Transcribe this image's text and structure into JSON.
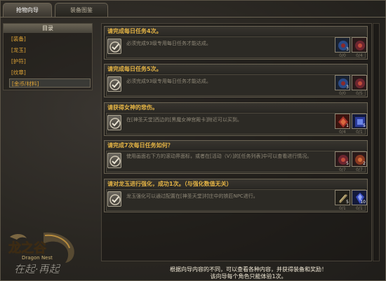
{
  "tabs": [
    {
      "label": "抢物向导"
    },
    {
      "label": "装备图鉴"
    }
  ],
  "sidebar": {
    "title": "目录",
    "items": [
      {
        "label": "[装备]"
      },
      {
        "label": "[龙玉]"
      },
      {
        "label": "[护符]"
      },
      {
        "label": "[纹章]"
      },
      {
        "label": "[金币/材料]"
      }
    ]
  },
  "logo": {
    "name": "龙之谷",
    "sub": "Dragon Nest",
    "slogan": "在起·再起"
  },
  "quests": [
    {
      "title": "请完成每日任务4次。",
      "desc": "必须完成93级专用每日任务才能达成。",
      "rewards": [
        {
          "icon": "blue-orb-icon",
          "count": "3",
          "sub": "0/0"
        },
        {
          "icon": "red-orb-icon",
          "count": "",
          "sub": "0/4"
        }
      ]
    },
    {
      "title": "请完成每日任务5次。",
      "desc": "必须完成93级专用每日任务才能达成。",
      "rewards": [
        {
          "icon": "blue-orb-icon",
          "count": "3",
          "sub": "0/0"
        },
        {
          "icon": "red-orb-icon",
          "count": "",
          "sub": "0/5"
        }
      ]
    },
    {
      "title": "请获得女神的悲伤。",
      "desc": "在[神圣天堂]西边的[黑魔女神宫殿卡]附近可以买到。",
      "rewards": [
        {
          "icon": "red-gem-icon",
          "count": "1",
          "sub": "0/4"
        },
        {
          "icon": "blue-gem-icon",
          "count": "5",
          "sub": "0/1"
        }
      ]
    },
    {
      "title": "请完成7次每日任务如何？",
      "desc": "使用画面右下方的滚动界面标，或者在[活动（V）]的[任务列表]中可以查看进行情况。",
      "rewards": [
        {
          "icon": "red-orb-icon",
          "count": "5",
          "sub": "0/7"
        },
        {
          "icon": "red-orb-icon",
          "count": "2",
          "sub": "0/7"
        }
      ]
    },
    {
      "title": "请对龙玉进行强化，成功1次。（与强化数值无关）",
      "desc": "龙玉强化可以通过配置在[神圣天堂]村庄中的铁匠NPC进行。",
      "rewards": [
        {
          "icon": "scroll-icon",
          "count": "5",
          "sub": "0/1"
        },
        {
          "icon": "blue-crystal-icon",
          "count": "10",
          "sub": "0/1"
        }
      ]
    }
  ],
  "footer": {
    "line1": "根据向导内容的不同，可以查看各种内容，并获得装备和奖励！",
    "line2": "该向导每个角色只能体验1次。"
  },
  "colors": {
    "accent": "#e6b545",
    "sidebar_item": "#e2a637",
    "panel": "#24221e"
  }
}
